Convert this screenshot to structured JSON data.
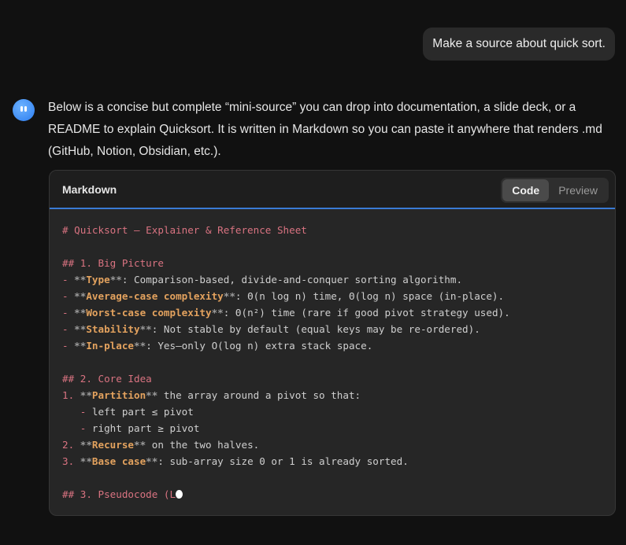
{
  "user_message": "Make a source about quick sort.",
  "assistant_intro": "Below is a concise but complete “mini-source” you can drop into documentation, a slide deck, or a README to explain Quicksort.  It is written in Markdown so you can paste it anywhere that renders .md (GitHub, Notion, Obsidian, etc.).",
  "code_block": {
    "language": "Markdown",
    "tabs": {
      "code": "Code",
      "preview": "Preview"
    },
    "lines": [
      [
        [
          "# Quicksort – Explainer & Reference Sheet",
          "h"
        ]
      ],
      [],
      [
        [
          "## 1. Big Picture",
          "h"
        ]
      ],
      [
        [
          "- ",
          "d"
        ],
        [
          "**",
          "m"
        ],
        [
          "Type",
          "b"
        ],
        [
          "**",
          "m"
        ],
        [
          ": Comparison-based, divide-and-conquer sorting algorithm.",
          "t"
        ]
      ],
      [
        [
          "- ",
          "d"
        ],
        [
          "**",
          "m"
        ],
        [
          "Average-case complexity",
          "b"
        ],
        [
          "**",
          "m"
        ],
        [
          ": Θ(n log n) time, Θ(log n) space (in-place).",
          "t"
        ]
      ],
      [
        [
          "- ",
          "d"
        ],
        [
          "**",
          "m"
        ],
        [
          "Worst-case complexity",
          "b"
        ],
        [
          "**",
          "m"
        ],
        [
          ": Θ(n²) time (rare if good pivot strategy used).",
          "t"
        ]
      ],
      [
        [
          "- ",
          "d"
        ],
        [
          "**",
          "m"
        ],
        [
          "Stability",
          "b"
        ],
        [
          "**",
          "m"
        ],
        [
          ": Not stable by default (equal keys may be re-ordered).",
          "t"
        ]
      ],
      [
        [
          "- ",
          "d"
        ],
        [
          "**",
          "m"
        ],
        [
          "In-place",
          "b"
        ],
        [
          "**",
          "m"
        ],
        [
          ": Yes—only O(log n) extra stack space.",
          "t"
        ]
      ],
      [],
      [
        [
          "## 2. Core Idea",
          "h"
        ]
      ],
      [
        [
          "1. ",
          "d"
        ],
        [
          "**",
          "m"
        ],
        [
          "Partition",
          "b"
        ],
        [
          "**",
          "m"
        ],
        [
          " the array around a pivot so that:",
          "t"
        ]
      ],
      [
        [
          "   - ",
          "d"
        ],
        [
          "left part ≤ pivot",
          "t"
        ]
      ],
      [
        [
          "   - ",
          "d"
        ],
        [
          "right part ≥ pivot",
          "t"
        ]
      ],
      [
        [
          "2. ",
          "d"
        ],
        [
          "**",
          "m"
        ],
        [
          "Recurse",
          "b"
        ],
        [
          "**",
          "m"
        ],
        [
          " on the two halves.",
          "t"
        ]
      ],
      [
        [
          "3. ",
          "d"
        ],
        [
          "**",
          "m"
        ],
        [
          "Base case",
          "b"
        ],
        [
          "**",
          "m"
        ],
        [
          ": sub-array size 0 or 1 is already sorted.",
          "t"
        ]
      ],
      [],
      [
        [
          "## 3. Pseudocode (L",
          "h"
        ]
      ]
    ]
  }
}
